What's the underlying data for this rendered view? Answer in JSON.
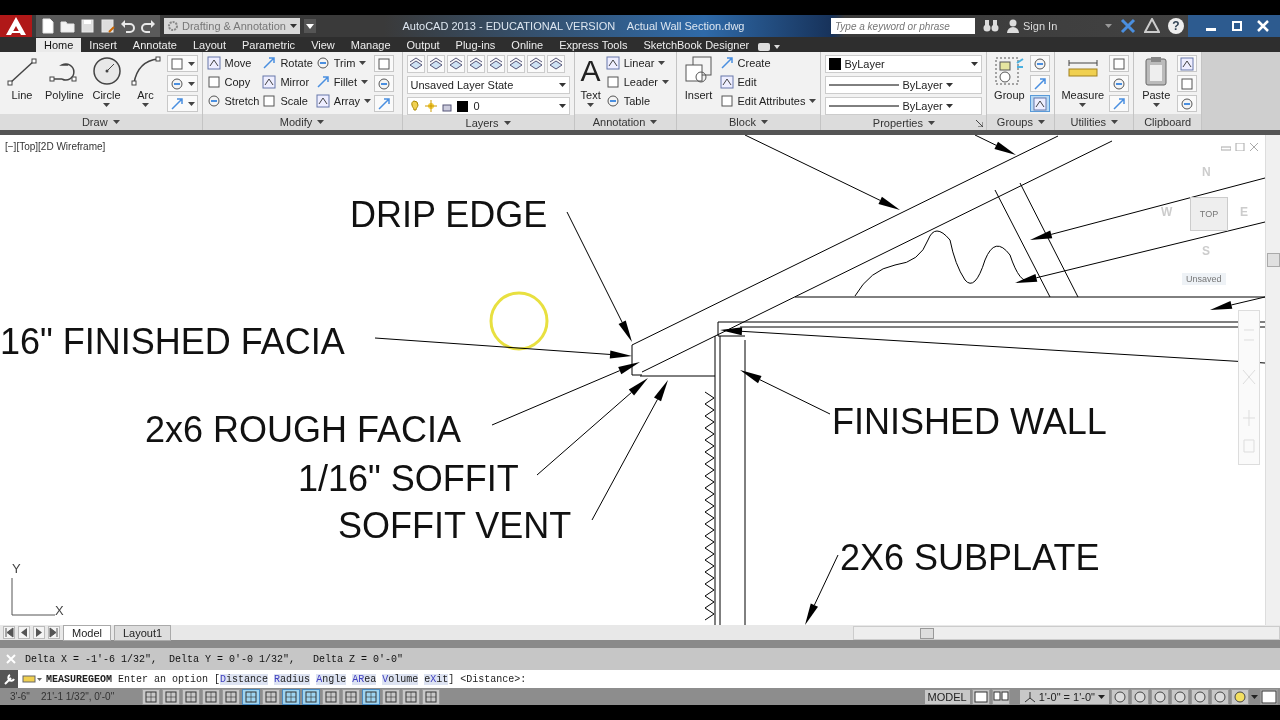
{
  "title_bar": {
    "workspace": "Drafting & Annotation",
    "title": "AutoCAD 2013 - EDUCATIONAL VERSION    Actual Wall Section.dwg",
    "search": {
      "placeholder": "Type a keyword or phrase"
    },
    "sign_in": "Sign In",
    "help": "?"
  },
  "ribbon_tabs": [
    {
      "label": "Home",
      "selected": true
    },
    {
      "label": "Insert",
      "selected": false
    },
    {
      "label": "Annotate",
      "selected": false
    },
    {
      "label": "Layout",
      "selected": false
    },
    {
      "label": "Parametric",
      "selected": false
    },
    {
      "label": "View",
      "selected": false
    },
    {
      "label": "Manage",
      "selected": false
    },
    {
      "label": "Output",
      "selected": false
    },
    {
      "label": "Plug-ins",
      "selected": false
    },
    {
      "label": "Online",
      "selected": false
    },
    {
      "label": "Express Tools",
      "selected": false
    },
    {
      "label": "SketchBook Designer",
      "selected": false
    }
  ],
  "ribbon_panels": [
    {
      "title": "Draw",
      "menu": true,
      "columns": [
        {
          "kind": "big",
          "label": "Line",
          "menu": false
        },
        {
          "kind": "big",
          "label": "Polyline",
          "menu": false
        },
        {
          "kind": "big",
          "label": "Circle",
          "menu": true
        },
        {
          "kind": "big",
          "label": "Arc",
          "menu": true
        },
        {
          "kind": "stack",
          "items": [
            {
              "menu": true
            },
            {
              "menu": true
            },
            {
              "menu": true
            }
          ]
        }
      ]
    },
    {
      "title": "Modify",
      "menu": true,
      "columns": [
        {
          "kind": "stack",
          "items": [
            {
              "label": "Move",
              "menu": false
            },
            {
              "label": "Copy",
              "menu": false
            },
            {
              "label": "Stretch",
              "menu": false
            }
          ]
        },
        {
          "kind": "stack",
          "items": [
            {
              "label": "Rotate",
              "menu": false
            },
            {
              "label": "Mirror",
              "menu": false
            },
            {
              "label": "Scale",
              "menu": false
            }
          ]
        },
        {
          "kind": "stack",
          "items": [
            {
              "label": "Trim",
              "menu": true
            },
            {
              "label": "Fillet",
              "menu": true
            },
            {
              "label": "Array",
              "menu": true
            }
          ]
        },
        {
          "kind": "stack",
          "items": [
            {
              "menu": false
            },
            {
              "menu": false
            },
            {
              "menu": false
            }
          ]
        }
      ]
    },
    {
      "title": "Layers",
      "menu": true,
      "columns": [
        {
          "kind": "layers",
          "combos": [
            {
              "text": "Unsaved Layer State",
              "kind": "plain"
            },
            {
              "text": "0",
              "kind": "layer"
            }
          ]
        }
      ]
    },
    {
      "title": "Annotation",
      "menu": true,
      "columns": [
        {
          "kind": "big",
          "label": "Text",
          "glyph": "A",
          "menu": true
        },
        {
          "kind": "stack",
          "items": [
            {
              "label": "Linear",
              "menu": true
            },
            {
              "label": "Leader",
              "menu": true
            },
            {
              "label": "Table",
              "menu": false
            }
          ]
        }
      ]
    },
    {
      "title": "Block",
      "menu": true,
      "columns": [
        {
          "kind": "big",
          "label": "Insert",
          "menu": false
        },
        {
          "kind": "stack",
          "items": [
            {
              "label": "Create",
              "menu": false
            },
            {
              "label": "Edit",
              "menu": false
            },
            {
              "label": "Edit Attributes",
              "menu": true
            }
          ]
        }
      ]
    },
    {
      "title": "Properties",
      "menu": true,
      "launcher": true,
      "columns": [
        {
          "kind": "combos",
          "combos": [
            {
              "text": "ByLayer",
              "kind": "swatch"
            },
            {
              "text": "ByLayer",
              "kind": "line"
            },
            {
              "text": "ByLayer",
              "kind": "line"
            }
          ]
        }
      ]
    },
    {
      "title": "Groups",
      "menu": true,
      "columns": [
        {
          "kind": "big",
          "label": "Group",
          "menu": false
        },
        {
          "kind": "stack",
          "items": [
            {
              "menu": false,
              "on": false
            },
            {
              "menu": false,
              "on": false
            },
            {
              "menu": false,
              "on": true
            }
          ]
        }
      ]
    },
    {
      "title": "Utilities",
      "menu": true,
      "columns": [
        {
          "kind": "big",
          "label": "Measure",
          "menu": true
        },
        {
          "kind": "stack",
          "items": [
            {
              "menu": false
            },
            {
              "menu": false
            },
            {
              "menu": false
            }
          ]
        }
      ]
    },
    {
      "title": "Clipboard",
      "menu": false,
      "columns": [
        {
          "kind": "big",
          "label": "Paste",
          "menu": true
        },
        {
          "kind": "stack",
          "items": [
            {
              "menu": false
            },
            {
              "menu": false
            },
            {
              "menu": false
            }
          ]
        }
      ]
    }
  ],
  "drawing": {
    "viewport_label": "[−][Top][2D Wireframe]",
    "callouts": [
      "DRIP EDGE",
      "16\" FINISHED FACIA",
      "2x6 ROUGH FACIA",
      "1/16\" SOFFIT",
      "SOFFIT VENT",
      "FINISHED WALL",
      "2X6 SUBPLATE"
    ],
    "viewcube": {
      "north": "N",
      "west": "W",
      "top": "TOP",
      "east": "E",
      "south": "S",
      "ucs": "Unsaved"
    },
    "ucs_icon": {
      "y": "Y",
      "x": "X"
    }
  },
  "layout_tabs": [
    {
      "label": "Model",
      "selected": true
    },
    {
      "label": "Layout1",
      "selected": false
    }
  ],
  "command": {
    "history": "Delta X = -1'-6 1/32\",  Delta Y = 0'-0 1/32\",   Delta Z = 0'-0\"",
    "name": "MEASUREGEOM",
    "prompt": "Enter an option [",
    "options": [
      {
        "key": "D",
        "after": "istance"
      },
      {
        "key": "R",
        "after": "adius"
      },
      {
        "key": "A",
        "after": "ngle"
      },
      {
        "key": "AR",
        "after": "ea"
      },
      {
        "key": "V",
        "after": "olume"
      },
      {
        "before": "e",
        "key": "X",
        "after": "it"
      }
    ],
    "tail": "] <Distance>:"
  },
  "status_bar": {
    "coordinates": "3'-6\"    21'-1 1/32\", 0'-0\"",
    "toggles": [
      {
        "on": false
      },
      {
        "on": false
      },
      {
        "on": false
      },
      {
        "on": false
      },
      {
        "on": false
      },
      {
        "on": true
      },
      {
        "on": false
      },
      {
        "on": true
      },
      {
        "on": true
      },
      {
        "on": false
      },
      {
        "on": false
      },
      {
        "on": true
      },
      {
        "on": false
      },
      {
        "on": false
      },
      {
        "on": false
      }
    ],
    "space": "MODEL",
    "scale": "1'-0\" = 1'-0\""
  }
}
